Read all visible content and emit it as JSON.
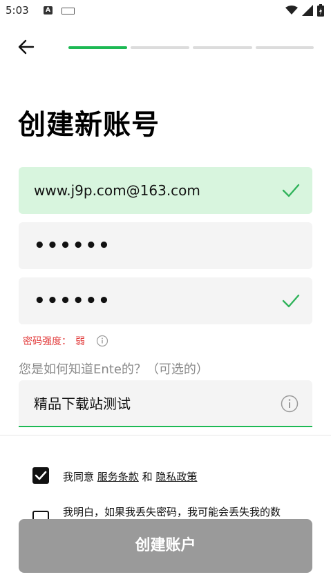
{
  "status_bar": {
    "time": "5:03",
    "notification_badge": "A",
    "icons": [
      "wifi-icon",
      "cell-signal-icon",
      "battery-charging-icon"
    ]
  },
  "progress": {
    "total_steps": 4,
    "current_step": 1,
    "active_color": "#1db954"
  },
  "page": {
    "title": "创建新账号"
  },
  "form": {
    "email_value": "www.j9p.com@163.com",
    "password_mask": "••••••",
    "confirm_password_mask": "••••••",
    "password_strength_label": "密码强度：",
    "password_strength_value": "弱",
    "source_question": "您是如何知道Ente的？（可选的）",
    "source_value": "精品下载站测试"
  },
  "consent": {
    "terms_prefix": "我同意",
    "terms_link": "服务条款",
    "and": "和",
    "privacy_link": "隐私政策",
    "terms_checked": true,
    "password_warning": "我明白，如果我丢失密码，我可能会丢失我的数",
    "password_warning_checked": false
  },
  "actions": {
    "create_account_label": "创建账户"
  },
  "colors": {
    "success_bg": "#d8f5de",
    "accent_green": "#1db954",
    "error_red": "#e23b3b",
    "disabled_button": "#9a9a9a"
  }
}
